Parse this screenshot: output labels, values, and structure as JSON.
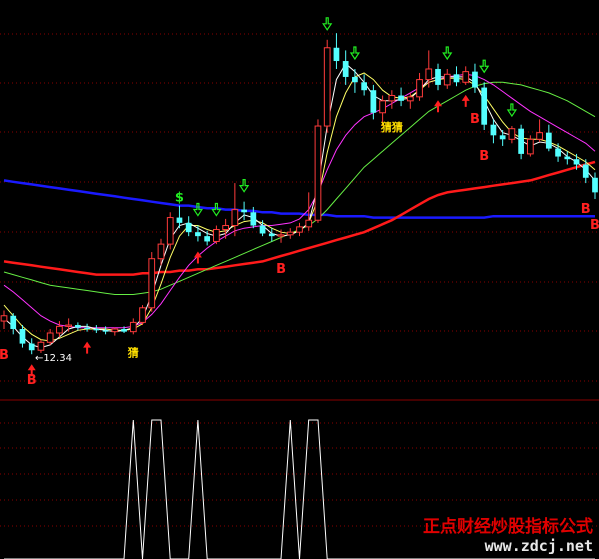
{
  "colors": {
    "background": "#000000",
    "grid": "#8a0000",
    "panel_divider": "#8a0000",
    "candle_up": "#ff3b3b",
    "candle_down": "#54ffff",
    "ma_blue": "#1a1aff",
    "ma_red": "#ff1a1a",
    "ma_white": "#ffffff",
    "ma_yellow": "#ffff66",
    "ma_magenta": "#ff33ff",
    "ma_green": "#66ee44",
    "buy_mark": "#ff2020",
    "sell_mark": "#22ee22",
    "label_yellow": "#ffe000"
  },
  "price_annotation": "12.34",
  "markers": {
    "buy_letter": "B",
    "guess_label": "猜",
    "guess_label_double": "猜猜",
    "dollar_label": "$"
  },
  "watermark": {
    "title": "正点财经炒股指标公式",
    "url": "www.zdcj.net"
  },
  "chart_data": [
    {
      "type": "candlestick",
      "title": "",
      "candles": [
        [
          12.58,
          12.66,
          12.52,
          12.62
        ],
        [
          12.62,
          12.64,
          12.48,
          12.52
        ],
        [
          12.52,
          12.55,
          12.38,
          12.41
        ],
        [
          12.41,
          12.45,
          12.33,
          12.36
        ],
        [
          12.36,
          12.44,
          12.34,
          12.42
        ],
        [
          12.42,
          12.52,
          12.4,
          12.49
        ],
        [
          12.49,
          12.58,
          12.46,
          12.54
        ],
        [
          12.54,
          12.6,
          12.5,
          12.55
        ],
        [
          12.55,
          12.57,
          12.51,
          12.53
        ],
        [
          12.53,
          12.56,
          12.5,
          12.52
        ],
        [
          12.52,
          12.55,
          12.49,
          12.51
        ],
        [
          12.51,
          12.54,
          12.48,
          12.5
        ],
        [
          12.5,
          12.53,
          12.47,
          12.52
        ],
        [
          12.52,
          12.54,
          12.49,
          12.5
        ],
        [
          12.5,
          12.6,
          12.48,
          12.57
        ],
        [
          12.57,
          12.7,
          12.55,
          12.68
        ],
        [
          12.68,
          13.1,
          12.65,
          13.05
        ],
        [
          13.05,
          13.2,
          13.0,
          13.16
        ],
        [
          13.16,
          13.4,
          13.12,
          13.36
        ],
        [
          13.36,
          13.45,
          13.28,
          13.32
        ],
        [
          13.32,
          13.37,
          13.22,
          13.25
        ],
        [
          13.25,
          13.3,
          13.18,
          13.22
        ],
        [
          13.22,
          13.26,
          13.15,
          13.18
        ],
        [
          13.18,
          13.3,
          13.16,
          13.27
        ],
        [
          13.27,
          13.35,
          13.2,
          13.3
        ],
        [
          13.3,
          13.62,
          13.22,
          13.42
        ],
        [
          13.42,
          13.48,
          13.34,
          13.4
        ],
        [
          13.4,
          13.44,
          13.28,
          13.3
        ],
        [
          13.3,
          13.34,
          13.22,
          13.24
        ],
        [
          13.24,
          13.28,
          13.18,
          13.22
        ],
        [
          13.22,
          13.27,
          13.17,
          13.23
        ],
        [
          13.23,
          13.28,
          13.2,
          13.25
        ],
        [
          13.25,
          13.32,
          13.22,
          13.29
        ],
        [
          13.29,
          13.55,
          13.26,
          13.34
        ],
        [
          13.34,
          14.1,
          13.32,
          14.05
        ],
        [
          14.05,
          14.7,
          14.0,
          14.64
        ],
        [
          14.64,
          14.75,
          14.48,
          14.54
        ],
        [
          14.54,
          14.62,
          14.36,
          14.42
        ],
        [
          14.42,
          14.48,
          14.3,
          14.38
        ],
        [
          14.38,
          14.44,
          14.28,
          14.32
        ],
        [
          14.32,
          14.36,
          14.1,
          14.15
        ],
        [
          14.15,
          14.28,
          14.05,
          14.24
        ],
        [
          14.24,
          14.32,
          14.18,
          14.28
        ],
        [
          14.28,
          14.34,
          14.2,
          14.24
        ],
        [
          14.24,
          14.3,
          14.18,
          14.27
        ],
        [
          14.27,
          14.45,
          14.24,
          14.4
        ],
        [
          14.4,
          14.62,
          14.34,
          14.48
        ],
        [
          14.48,
          14.52,
          14.32,
          14.36
        ],
        [
          14.36,
          14.48,
          14.33,
          14.44
        ],
        [
          14.44,
          14.5,
          14.35,
          14.38
        ],
        [
          14.38,
          14.5,
          14.36,
          14.46
        ],
        [
          14.46,
          14.52,
          14.3,
          14.34
        ],
        [
          14.34,
          14.38,
          14.02,
          14.06
        ],
        [
          14.06,
          14.1,
          13.92,
          13.98
        ],
        [
          13.98,
          14.02,
          13.9,
          13.95
        ],
        [
          13.95,
          14.05,
          13.92,
          14.03
        ],
        [
          14.03,
          14.06,
          13.8,
          13.84
        ],
        [
          13.84,
          13.98,
          13.82,
          13.95
        ],
        [
          13.95,
          14.1,
          13.93,
          14.0
        ],
        [
          14.0,
          14.06,
          13.86,
          13.88
        ],
        [
          13.88,
          13.92,
          13.78,
          13.82
        ],
        [
          13.82,
          13.86,
          13.76,
          13.8
        ],
        [
          13.8,
          13.84,
          13.72,
          13.76
        ],
        [
          13.76,
          13.8,
          13.62,
          13.66
        ],
        [
          13.66,
          13.7,
          13.5,
          13.55
        ]
      ],
      "candle_fields": [
        "open",
        "high",
        "low",
        "close"
      ],
      "series": [
        {
          "color": "#1a1aff",
          "values": [
            13.64,
            13.63,
            13.62,
            13.61,
            13.6,
            13.59,
            13.58,
            13.57,
            13.56,
            13.55,
            13.54,
            13.53,
            13.52,
            13.51,
            13.5,
            13.49,
            13.48,
            13.47,
            13.46,
            13.45,
            13.45,
            13.44,
            13.43,
            13.43,
            13.42,
            13.42,
            13.41,
            13.41,
            13.4,
            13.4,
            13.39,
            13.39,
            13.39,
            13.38,
            13.38,
            13.38,
            13.37,
            13.37,
            13.37,
            13.37,
            13.36,
            13.36,
            13.36,
            13.36,
            13.36,
            13.36,
            13.36,
            13.36,
            13.36,
            13.36,
            13.36,
            13.36,
            13.36,
            13.37,
            13.37,
            13.37,
            13.37,
            13.37,
            13.37,
            13.37,
            13.37,
            13.37,
            13.37,
            13.37,
            13.37
          ]
        },
        {
          "color": "#ff1a1a",
          "values": [
            13.03,
            13.02,
            13.01,
            13.0,
            12.99,
            12.98,
            12.97,
            12.96,
            12.95,
            12.94,
            12.93,
            12.93,
            12.93,
            12.93,
            12.93,
            12.94,
            12.94,
            12.95,
            12.95,
            12.96,
            12.96,
            12.97,
            12.97,
            12.98,
            12.99,
            13.0,
            13.01,
            13.02,
            13.03,
            13.05,
            13.07,
            13.09,
            13.11,
            13.13,
            13.15,
            13.17,
            13.19,
            13.21,
            13.23,
            13.25,
            13.28,
            13.31,
            13.34,
            13.38,
            13.42,
            13.46,
            13.5,
            13.53,
            13.55,
            13.56,
            13.57,
            13.58,
            13.59,
            13.6,
            13.61,
            13.62,
            13.63,
            13.64,
            13.66,
            13.68,
            13.7,
            13.72,
            13.74,
            13.76,
            13.78
          ]
        },
        {
          "color": "#66ee44",
          "values": [
            12.95,
            12.93,
            12.91,
            12.89,
            12.87,
            12.85,
            12.84,
            12.83,
            12.82,
            12.81,
            12.8,
            12.79,
            12.78,
            12.78,
            12.78,
            12.79,
            12.8,
            12.82,
            12.85,
            12.88,
            12.91,
            12.94,
            12.97,
            13.0,
            13.03,
            13.06,
            13.09,
            13.12,
            13.15,
            13.18,
            13.21,
            13.24,
            13.27,
            13.3,
            13.35,
            13.42,
            13.5,
            13.58,
            13.66,
            13.74,
            13.8,
            13.86,
            13.92,
            13.98,
            14.04,
            14.1,
            14.16,
            14.2,
            14.24,
            14.28,
            14.32,
            14.35,
            14.37,
            14.38,
            14.38,
            14.37,
            14.36,
            14.34,
            14.32,
            14.3,
            14.27,
            14.24,
            14.2,
            14.16,
            14.12
          ]
        },
        {
          "color": "#ff33ff",
          "values": [
            12.85,
            12.8,
            12.74,
            12.68,
            12.62,
            12.58,
            12.55,
            12.54,
            12.53,
            12.53,
            12.53,
            12.53,
            12.53,
            12.53,
            12.54,
            12.57,
            12.63,
            12.71,
            12.81,
            12.91,
            13.0,
            13.07,
            13.13,
            13.18,
            13.22,
            13.26,
            13.28,
            13.29,
            13.3,
            13.3,
            13.31,
            13.32,
            13.35,
            13.42,
            13.55,
            13.72,
            13.87,
            13.98,
            14.06,
            14.12,
            14.15,
            14.18,
            14.22,
            14.26,
            14.3,
            14.34,
            14.38,
            14.4,
            14.42,
            14.43,
            14.44,
            14.43,
            14.4,
            14.36,
            14.31,
            14.26,
            14.21,
            14.16,
            14.12,
            14.08,
            14.04,
            14.0,
            13.96,
            13.92,
            13.86
          ]
        },
        {
          "color": "#ffff66",
          "values": [
            12.7,
            12.62,
            12.54,
            12.48,
            12.44,
            12.43,
            12.45,
            12.48,
            12.51,
            12.52,
            12.52,
            12.52,
            12.51,
            12.51,
            12.52,
            12.56,
            12.68,
            12.86,
            13.06,
            13.22,
            13.3,
            13.3,
            13.27,
            13.25,
            13.26,
            13.3,
            13.33,
            13.34,
            13.32,
            13.28,
            13.25,
            13.24,
            13.26,
            13.32,
            13.5,
            13.85,
            14.12,
            14.3,
            14.42,
            14.45,
            14.4,
            14.32,
            14.27,
            14.26,
            14.27,
            14.32,
            14.38,
            14.4,
            14.41,
            14.41,
            14.4,
            14.36,
            14.28,
            14.18,
            14.08,
            14.0,
            13.96,
            13.95,
            13.95,
            13.93,
            13.9,
            13.86,
            13.82,
            13.78,
            13.72
          ]
        },
        {
          "color": "#ffffff",
          "values": [
            12.6,
            12.54,
            12.46,
            12.4,
            12.38,
            12.4,
            12.46,
            12.52,
            12.54,
            12.54,
            12.52,
            12.51,
            12.5,
            12.51,
            12.53,
            12.6,
            12.78,
            13.0,
            13.2,
            13.3,
            13.32,
            13.28,
            13.24,
            13.22,
            13.24,
            13.32,
            13.38,
            13.36,
            13.3,
            13.24,
            13.22,
            13.23,
            13.26,
            13.32,
            13.6,
            14.05,
            14.4,
            14.52,
            14.46,
            14.38,
            14.28,
            14.24,
            14.24,
            14.25,
            14.26,
            14.32,
            14.4,
            14.42,
            14.42,
            14.42,
            14.42,
            14.38,
            14.24,
            14.1,
            14.0,
            13.98,
            13.94,
            13.9,
            13.93,
            13.92,
            13.88,
            13.82,
            13.78,
            13.72,
            13.64
          ]
        }
      ],
      "annotations": {
        "buy_up_arrows": [
          3,
          9,
          21,
          47,
          50
        ],
        "sell_down_arrows": [
          21,
          23,
          26,
          35,
          38,
          48,
          52,
          55
        ],
        "b_labels": [
          0,
          3,
          30,
          51,
          52,
          63,
          66
        ],
        "guess_labels": [
          14,
          42
        ],
        "dollar_labels": [
          19
        ],
        "low_marker_index": 4
      },
      "ylim": [
        12.0,
        15.0
      ]
    },
    {
      "type": "line",
      "title": "",
      "x": [
        0,
        1,
        2,
        3,
        4,
        5,
        6,
        7,
        8,
        9,
        10,
        11,
        12,
        13,
        14,
        15,
        16,
        17,
        18,
        19,
        20,
        21,
        22,
        23,
        24,
        25,
        26,
        27,
        28,
        29,
        30,
        31,
        32,
        33,
        34,
        35,
        36,
        37,
        38,
        39,
        40,
        41,
        42,
        43,
        44,
        45,
        46,
        47,
        48,
        49,
        50,
        51,
        52,
        53,
        54,
        55,
        56,
        57,
        58,
        59,
        60,
        61,
        62,
        63,
        64
      ],
      "values": [
        0,
        0,
        0,
        0,
        0,
        0,
        0,
        0,
        0,
        0,
        0,
        0,
        0,
        0,
        1,
        0,
        1,
        1,
        0,
        0,
        0,
        1,
        0,
        0,
        0,
        0,
        0,
        0,
        0,
        0,
        0,
        1,
        0,
        1,
        1,
        0,
        0,
        0,
        0,
        0,
        0,
        0,
        0,
        0,
        0,
        0,
        0,
        0,
        0,
        0,
        0,
        0,
        0,
        0,
        0,
        0,
        0,
        0,
        0,
        0,
        0,
        0,
        0,
        0,
        0
      ],
      "ylim": [
        0,
        1
      ]
    }
  ]
}
